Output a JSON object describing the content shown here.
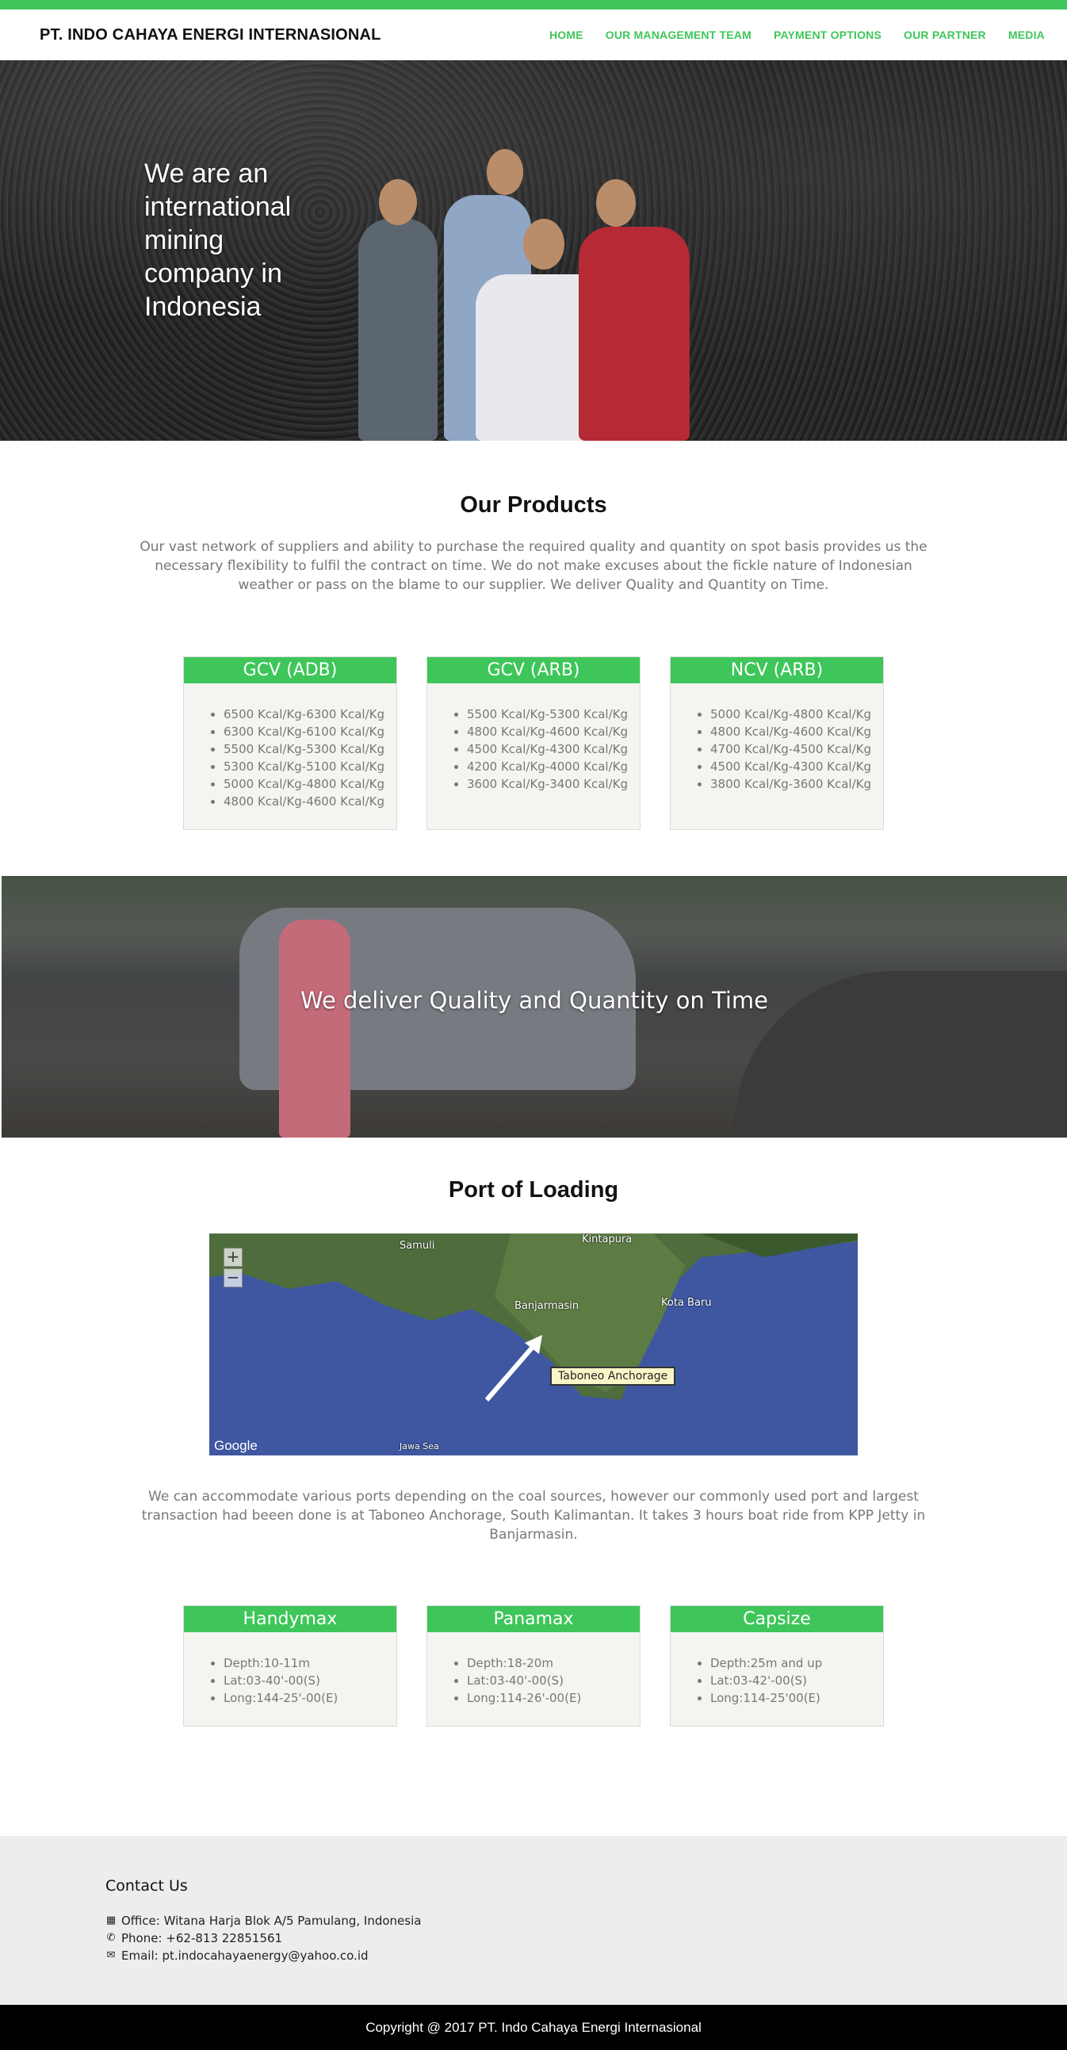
{
  "header": {
    "brand": "PT. INDO CAHAYA ENERGI INTERNASIONAL",
    "nav": [
      "HOME",
      "OUR MANAGEMENT TEAM",
      "PAYMENT OPTIONS",
      "OUR PARTNER",
      "MEDIA"
    ]
  },
  "hero": {
    "text": "We are an international mining company in Indonesia"
  },
  "products": {
    "title": "Our Products",
    "description": "Our vast network of suppliers and ability to purchase the required quality and quantity on spot basis provides us the necessary flexibility to fulfil the contract on time. We do not make excuses about the fickle nature of Indonesian weather or pass on the blame to our supplier. We deliver Quality and Quantity on Time.",
    "cards": [
      {
        "title": "GCV (ADB)",
        "items": [
          "6500 Kcal/Kg-6300 Kcal/Kg",
          "6300 Kcal/Kg-6100 Kcal/Kg",
          "5500 Kcal/Kg-5300 Kcal/Kg",
          "5300 Kcal/Kg-5100 Kcal/Kg",
          "5000 Kcal/Kg-4800 Kcal/Kg",
          "4800 Kcal/Kg-4600 Kcal/Kg"
        ]
      },
      {
        "title": "GCV (ARB)",
        "items": [
          "5500 Kcal/Kg-5300 Kcal/Kg",
          "4800 Kcal/Kg-4600 Kcal/Kg",
          "4500 Kcal/Kg-4300 Kcal/Kg",
          "4200 Kcal/Kg-4000 Kcal/Kg",
          "3600 Kcal/Kg-3400 Kcal/Kg"
        ]
      },
      {
        "title": "NCV (ARB)",
        "items": [
          "5000 Kcal/Kg-4800 Kcal/Kg",
          "4800 Kcal/Kg-4600 Kcal/Kg",
          "4700 Kcal/Kg-4500 Kcal/Kg",
          "4500 Kcal/Kg-4300 Kcal/Kg",
          "3800 Kcal/Kg-3600 Kcal/Kg"
        ]
      }
    ]
  },
  "band": {
    "text": "We deliver Quality and Quantity on Time"
  },
  "port": {
    "title": "Port of Loading",
    "map": {
      "labels": [
        "Banjarmasin",
        "Kota Baru",
        "Samuli",
        "Kintapura",
        "Jawa Sea"
      ],
      "callout": "Taboneo Anchorage",
      "logo": "Google",
      "zoom_in": "+",
      "zoom_out": "−"
    },
    "description": "We can accommodate various ports depending on the coal sources, however our commonly used port and largest transaction had beeen done is at Taboneo Anchorage, South Kalimantan. It takes 3 hours boat ride from KPP Jetty in Banjarmasin.",
    "cards": [
      {
        "title": "Handymax",
        "items": [
          "Depth:10-11m",
          "Lat:03-40'-00(S)",
          "Long:144-25'-00(E)"
        ]
      },
      {
        "title": "Panamax",
        "items": [
          "Depth:18-20m",
          "Lat:03-40'-00(S)",
          "Long:114-26'-00(E)"
        ]
      },
      {
        "title": "Capsize",
        "items": [
          "Depth:25m and up",
          "Lat:03-42'-00(S)",
          "Long:114-25'00(E)"
        ]
      }
    ]
  },
  "contact": {
    "title": "Contact Us",
    "office": "Office: Witana Harja Blok A/5 Pamulang, Indonesia",
    "phone": "Phone: +62-813 22851561",
    "email": "Email: pt.indocahayaenergy@yahoo.co.id"
  },
  "footer": {
    "copyright": "Copyright @ 2017 PT. Indo Cahaya Energi Internasional"
  },
  "colors": {
    "accent": "#3ec65a",
    "footer_bg": "#000000",
    "contact_bg": "#ecedef"
  }
}
